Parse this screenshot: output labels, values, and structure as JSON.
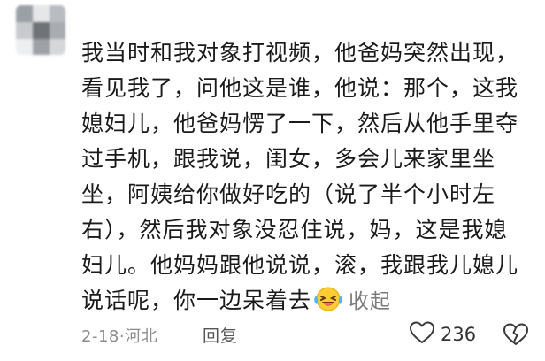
{
  "comment": {
    "lines": [
      "我当时和我对象打视频，他爸妈突然出现，",
      "看见我了，问他这是谁，他说：那个，这我",
      "媳妇儿，他爸妈愣了一下，然后从他手里夺",
      "过手机，跟我说，闺女，多会儿来家里坐",
      "坐，阿姨给你做好吃的（说了半个小时左",
      "右），然后我对象没忍住说，妈，这是我媳",
      "妇儿。他妈妈跟他说说，滚，我跟我儿媳儿",
      "说话呢，你一边呆着去"
    ],
    "emoji_icon": "laughing-crying-emoji",
    "collapse_label": "收起"
  },
  "meta": {
    "date": "2-18",
    "separator": "·",
    "location": "河北",
    "reply_label": "回复"
  },
  "actions": {
    "like_icon": "heart-outline-icon",
    "like_count": "236",
    "dislike_icon": "broken-heart-outline-icon"
  },
  "colors": {
    "text": "#1a1a1a",
    "secondary": "#8c8c8c",
    "collapse": "#7b7b7b"
  }
}
